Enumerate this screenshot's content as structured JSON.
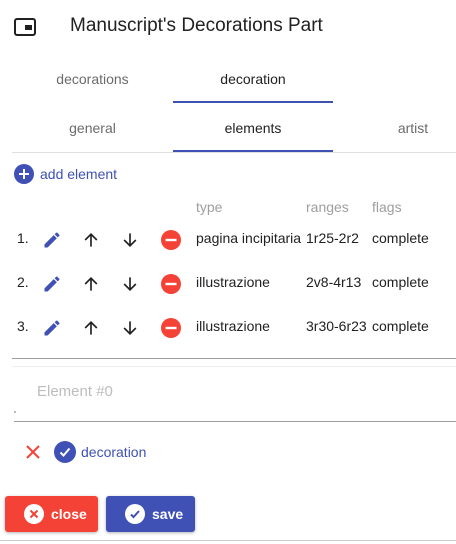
{
  "header": {
    "title": "Manuscript's Decorations Part",
    "icon": "dialog-window-icon"
  },
  "outer_tabs": [
    {
      "label": "decorations",
      "active": false
    },
    {
      "label": "decoration",
      "active": true
    }
  ],
  "inner_tabs": [
    {
      "label": "general",
      "active": false
    },
    {
      "label": "elements",
      "active": true
    },
    {
      "label": "artist",
      "active": false
    }
  ],
  "add_element_label": "add element",
  "columns": {
    "type": "type",
    "ranges": "ranges",
    "flags": "flags"
  },
  "rows": [
    {
      "num": "1.",
      "type": "pagina incipitaria",
      "ranges": "1r25-2r2",
      "flags": "complete"
    },
    {
      "num": "2.",
      "type": "illustrazione",
      "ranges": "2v8-4r13",
      "flags": "complete"
    },
    {
      "num": "3.",
      "type": "illustrazione",
      "ranges": "3r30-6r23",
      "flags": "complete"
    }
  ],
  "element_editor": {
    "placeholder": "Element #0"
  },
  "decoration_chip": "decoration",
  "buttons": {
    "close": "close",
    "save": "save"
  },
  "colors": {
    "primary": "#3f51b5",
    "warn": "#f44336",
    "text": "#212121",
    "muted": "#9e9e9e"
  }
}
